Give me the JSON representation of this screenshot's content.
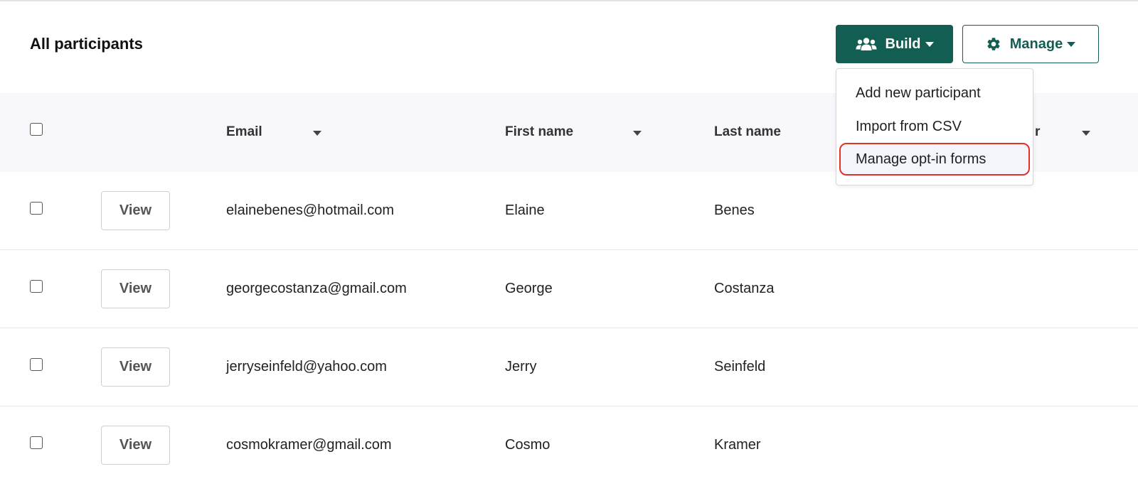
{
  "header": {
    "title": "All participants",
    "build_label": "Build",
    "manage_label": "Manage",
    "build_icon": "users-icon",
    "manage_icon": "gear-icon"
  },
  "colors": {
    "brand": "#135e53",
    "highlight": "#e0312b"
  },
  "table": {
    "columns": [
      {
        "label": "Email"
      },
      {
        "label": "First name"
      },
      {
        "label": "Last name"
      },
      {
        "label": "r"
      }
    ],
    "view_label": "View",
    "rows": [
      {
        "email": "elainebenes@hotmail.com",
        "first": "Elaine",
        "last": "Benes"
      },
      {
        "email": "georgecostanza@gmail.com",
        "first": "George",
        "last": "Costanza"
      },
      {
        "email": "jerryseinfeld@yahoo.com",
        "first": "Jerry",
        "last": "Seinfeld"
      },
      {
        "email": "cosmokramer@gmail.com",
        "first": "Cosmo",
        "last": "Kramer"
      }
    ]
  },
  "build_menu": {
    "items": [
      {
        "label": "Add new participant"
      },
      {
        "label": "Import from CSV"
      },
      {
        "label": "Manage opt-in forms",
        "highlighted": true
      }
    ]
  }
}
